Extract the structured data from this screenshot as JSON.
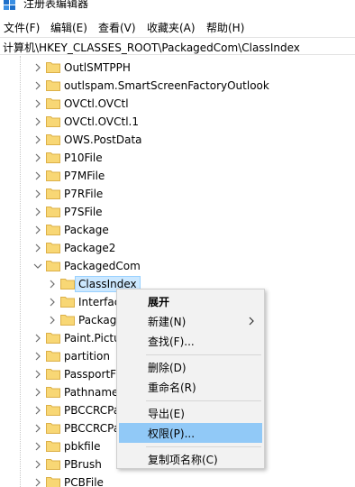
{
  "window": {
    "title": "注册表编辑器"
  },
  "menu": [
    "文件(F)",
    "编辑(E)",
    "查看(V)",
    "收藏夹(A)",
    "帮助(H)"
  ],
  "address": "计算机\\HKEY_CLASSES_ROOT\\PackagedCom\\ClassIndex",
  "tree": {
    "items": [
      "OutlSMTPPH",
      "outlspam.SmartScreenFactoryOutlook",
      "OVCtl.OVCtl",
      "OVCtl.OVCtl.1",
      "OWS.PostData",
      "P10File",
      "P7MFile",
      "P7RFile",
      "P7SFile",
      "Package",
      "Package2",
      "PackagedCom",
      "ClassIndex",
      "Interfac",
      "Packag",
      "Paint.Pictu",
      "partition",
      "PassportF",
      "Pathname",
      "PBCCRCPa",
      "PBCCRCPa",
      "pbkfile",
      "PBrush",
      "PCBFile"
    ]
  },
  "context_menu": {
    "expand": "展开",
    "new": "新建(N)",
    "find": "查找(F)...",
    "delete": "删除(D)",
    "rename": "重命名(R)",
    "export": "导出(E)",
    "permissions": "权限(P)...",
    "copy_key_name": "复制项名称(C)"
  },
  "colors": {
    "selection": "#cce8ff",
    "menu_hover": "#91c9f7",
    "folder": "#f8d775"
  }
}
